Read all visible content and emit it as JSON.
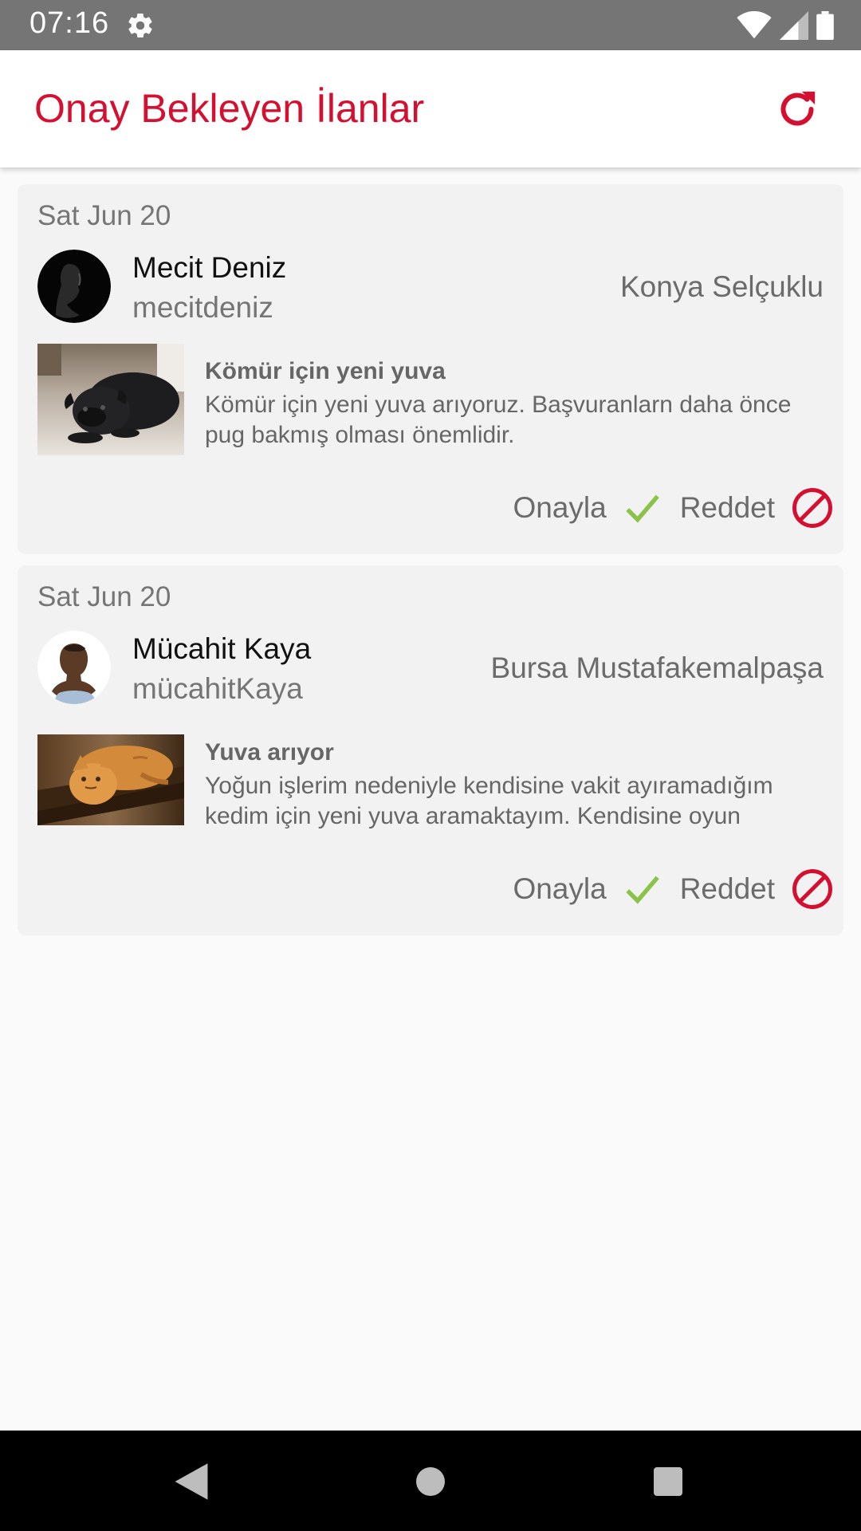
{
  "status_bar": {
    "time": "07:16"
  },
  "app_bar": {
    "title": "Onay Bekleyen İlanlar"
  },
  "colors": {
    "accent": "#d50f2f",
    "approve": "#8bc34a",
    "card_bg": "#f2f2f2"
  },
  "listings": [
    {
      "date": "Sat Jun 20",
      "user_name": "Mecit Deniz",
      "username": "mecitdeniz",
      "location": "Konya Selçuklu",
      "title": "Kömür için yeni yuva",
      "description": "Kömür için yeni yuva arıyoruz. Başvuranlarn  daha önce pug bakmış olması önemlidir.",
      "approve_label": "Onayla",
      "reject_label": "Reddet"
    },
    {
      "date": "Sat Jun 20",
      "user_name": "Mücahit Kaya",
      "username": "mücahitKaya",
      "location": "Bursa Mustafakemalpaşa",
      "title": "Yuva arıyor",
      "description": "Yoğun işlerim nedeniyle kendisine vakit ayıramadığım kedim için yeni yuva aramaktayım. Kendisine oyun",
      "approve_label": "Onayla",
      "reject_label": "Reddet"
    }
  ],
  "icons": {
    "settings": "gear-icon",
    "refresh": "refresh-icon",
    "approve": "check-icon",
    "reject": "ban-icon"
  }
}
